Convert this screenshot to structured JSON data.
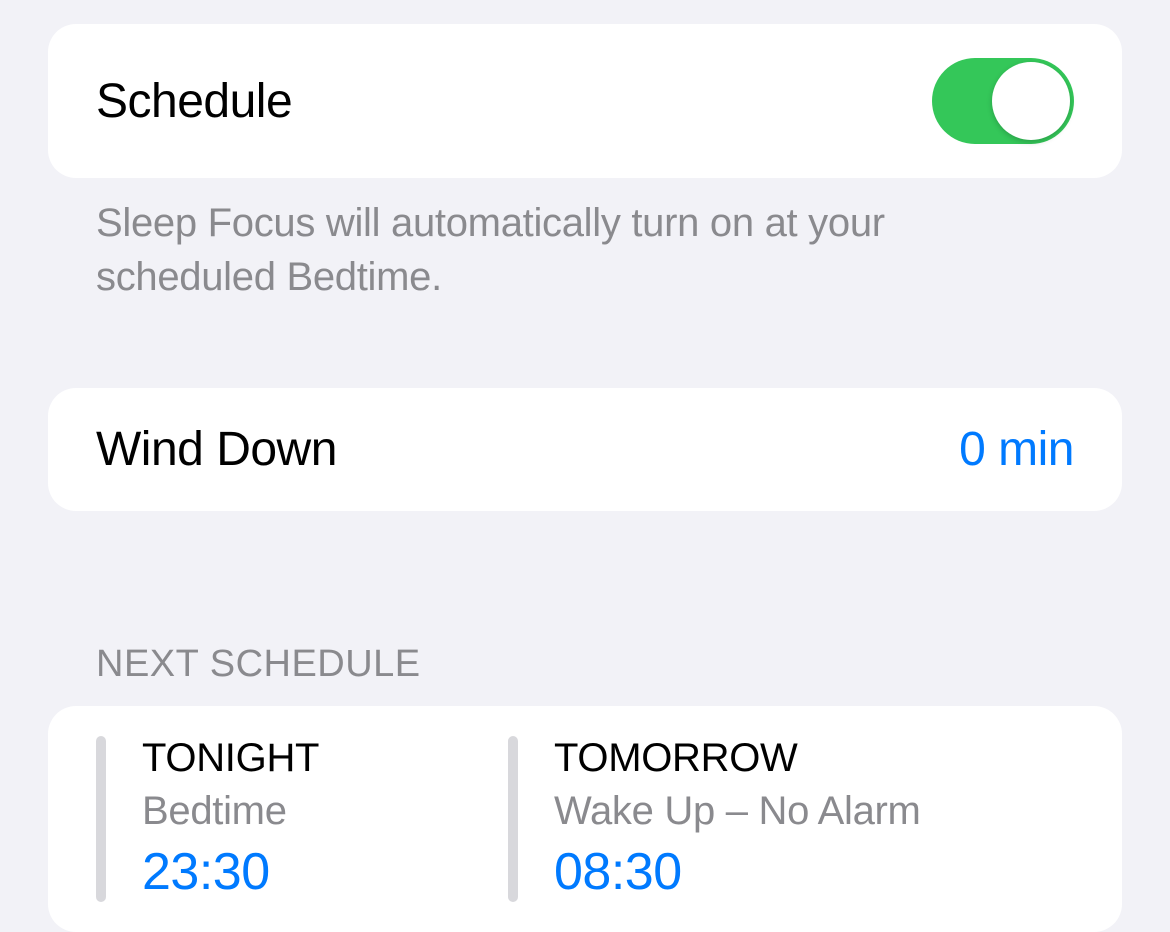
{
  "schedule": {
    "label": "Schedule",
    "enabled": true,
    "description": "Sleep Focus will automatically turn on at your scheduled Bedtime."
  },
  "windDown": {
    "label": "Wind Down",
    "value": "0 min"
  },
  "nextSchedule": {
    "header": "NEXT SCHEDULE",
    "tonight": {
      "title": "TONIGHT",
      "subtitle": "Bedtime",
      "time": "23:30"
    },
    "tomorrow": {
      "title": "TOMORROW",
      "subtitle": "Wake Up – No Alarm",
      "time": "08:30"
    }
  },
  "colors": {
    "accent": "#007aff",
    "toggleOn": "#34c759",
    "secondaryText": "#8a8a8e",
    "background": "#f2f2f7"
  }
}
